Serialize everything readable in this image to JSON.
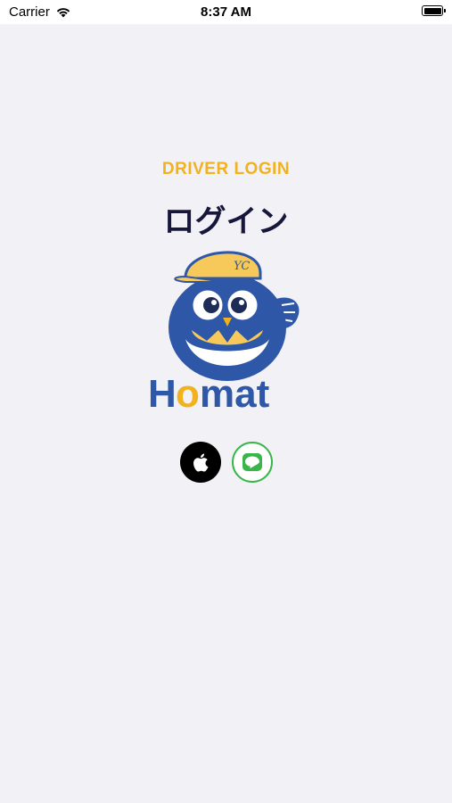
{
  "status": {
    "carrier": "Carrier",
    "time": "8:37 AM"
  },
  "header": {
    "subtitle": "DRIVER LOGIN",
    "title": "ログイン"
  },
  "brand": {
    "name": "Homat",
    "colors": {
      "primary": "#2f57a8",
      "accent": "#f0b21f"
    }
  },
  "login_options": [
    {
      "name": "apple",
      "icon": "apple-icon"
    },
    {
      "name": "line",
      "icon": "line-icon",
      "badge": "LINE"
    }
  ],
  "colors": {
    "background": "#f1f1f6",
    "title": "#16173a",
    "subtitle": "#f0b21f",
    "line_green": "#39b54a"
  }
}
